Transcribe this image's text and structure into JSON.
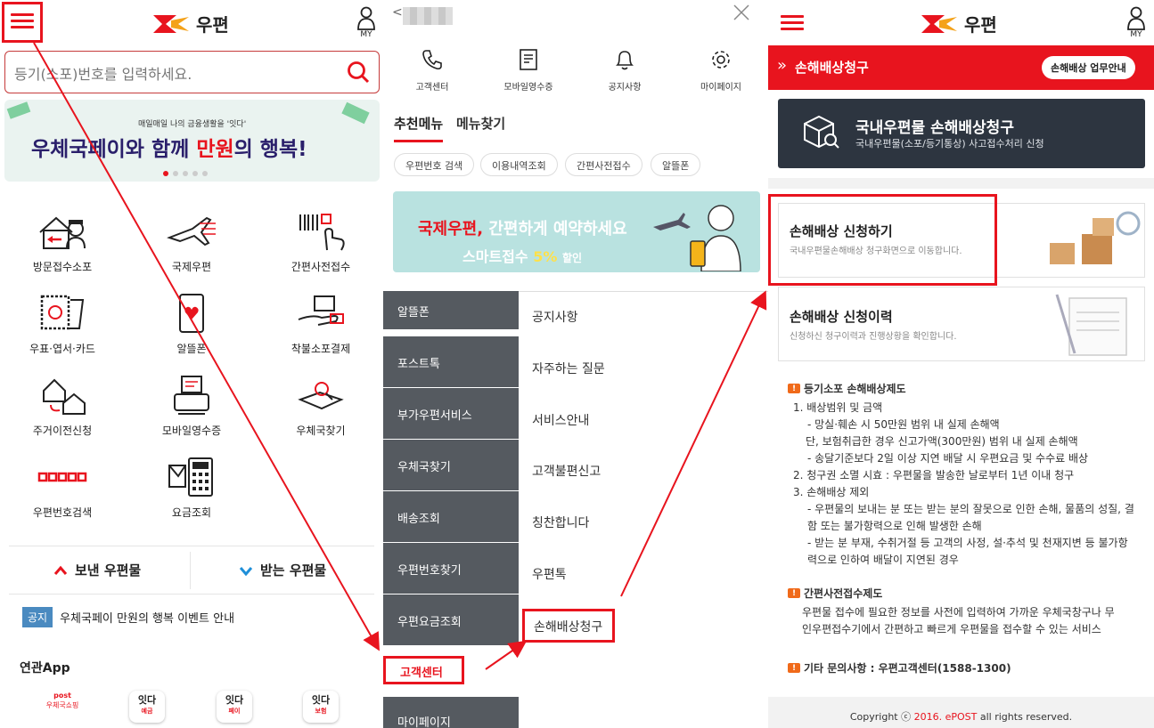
{
  "panel1": {
    "logo_text": "우편",
    "my_label": "MY",
    "search_placeholder": "등기(소포)번호를 입력하세요.",
    "banner": {
      "small": "매일매일 나의 금융생활을 '잇다'",
      "big1": "우체국페이와 함께",
      "big2": "만원",
      "big3": "의 행복!"
    },
    "services": [
      {
        "label": "방문접수소포",
        "icon": "home-courier-icon"
      },
      {
        "label": "국제우편",
        "icon": "airplane-icon"
      },
      {
        "label": "간편사전접수",
        "icon": "barcode-hand-icon"
      },
      {
        "label": "우표·엽서·카드",
        "icon": "stamp-icon"
      },
      {
        "label": "알뜰폰",
        "icon": "smartphone-icon"
      },
      {
        "label": "착불소포결제",
        "icon": "parcel-payment-icon"
      },
      {
        "label": "주거이전신청",
        "icon": "house-move-icon"
      },
      {
        "label": "모바일영수증",
        "icon": "receipt-icon"
      },
      {
        "label": "우체국찾기",
        "icon": "map-search-icon"
      },
      {
        "label": "우편번호검색",
        "icon": "postcode-icon"
      },
      {
        "label": "요금조회",
        "icon": "calculator-icon"
      }
    ],
    "send_label": "보낸 우편물",
    "receive_label": "받는 우편물",
    "notice_badge": "공지",
    "notice_text": "우체국페이 만원의 행복 이벤트 안내",
    "related_app_title": "연관App",
    "apps": [
      {
        "l1": "post",
        "l2": "우체국쇼핑"
      },
      {
        "l1": "잇다",
        "l2": "예금"
      },
      {
        "l1": "잇다",
        "l2": "페이"
      },
      {
        "l1": "잇다",
        "l2": "보험"
      }
    ]
  },
  "panel2": {
    "back_label": "<",
    "top_icons": [
      {
        "label": "고객센터",
        "icon": "phone-icon"
      },
      {
        "label": "모바일영수증",
        "icon": "receipt-icon"
      },
      {
        "label": "공지사항",
        "icon": "bell-icon"
      },
      {
        "label": "마이페이지",
        "icon": "gear-icon"
      }
    ],
    "tab_recommended": "추천메뉴",
    "tab_find": "메뉴찾기",
    "tags": [
      "우편번호 검색",
      "이용내역조회",
      "간편사전접수",
      "알뜰폰"
    ],
    "banner": {
      "t1": "국제우편,",
      "t2": "간편하게 예약하세요",
      "t3": "스마트접수",
      "t4": "5%",
      "t5": "할인"
    },
    "left_menu": [
      "알뜰폰",
      "포스트톡",
      "부가우편서비스",
      "우체국찾기",
      "배송조회",
      "우편번호찾기",
      "우편요금조회",
      "고객센터",
      "마이페이지"
    ],
    "right_menu": [
      "공지사항",
      "자주하는 질문",
      "서비스안내",
      "고객불편신고",
      "칭찬합니다",
      "우편톡",
      "손해배상청구"
    ]
  },
  "panel3": {
    "logo_text": "우편",
    "my_label": "MY",
    "header_title": "손해배상청구",
    "header_chevron": "»",
    "header_button": "손해배상 업무안내",
    "dark_title": "국내우편물 손해배상청구",
    "dark_sub": "국내우편물(소포/등기통상) 사고접수처리 신청",
    "card1_title": "손해배상 신청하기",
    "card1_sub": "국내우편물손해배상 청구화면으로 이동합니다.",
    "card2_title": "손해배상 신청이력",
    "card2_sub": "신청하신 청구이력과 진행상황을 확인합니다.",
    "info1_title": "등기소포 손해배상제도",
    "info1_lines": [
      "1. 배상범위 및 금액",
      "- 망실·훼손 시 50만원 범위 내 실제 손해액",
      "단, 보험취급한 경우 신고가액(300만원) 범위 내 실제 손해액",
      "- 송달기준보다 2일 이상 지연 배달 시 우편요금 및 수수료 배상",
      "2. 청구권 소멸 시효 : 우편물을 발송한 날로부터 1년 이내 청구",
      "3. 손해배상 제외",
      "- 우편물의 보내는 분 또는 받는 분의 잘못으로 인한 손해, 물품의 성질, 결",
      "함 또는 불가항력으로 인해 발생한 손해",
      "- 받는 분 부재, 수취거절 등 고객의 사정, 설·추석 및 천재지변 등 불가항",
      "력으로 인하여 배달이 지연된 경우"
    ],
    "info2_title": "간편사전접수제도",
    "info2_lines": [
      "우편물 접수에 필요한 정보를 사전에 입력하여 가까운 우체국창구나 무",
      "인우편접수기에서 간편하고 빠르게 우편물을 접수할 수 있는 서비스"
    ],
    "info3_title": "기타 문의사항 : 우편고객센터(1588-1300)",
    "copyright_pre": "Copyright ⓒ ",
    "copyright_brand": "2016. ePOST",
    "copyright_post": " all rights reserved."
  },
  "colors": {
    "accent": "#e8141e",
    "menu_dark": "#555a60",
    "card_dark": "#2d3540"
  }
}
